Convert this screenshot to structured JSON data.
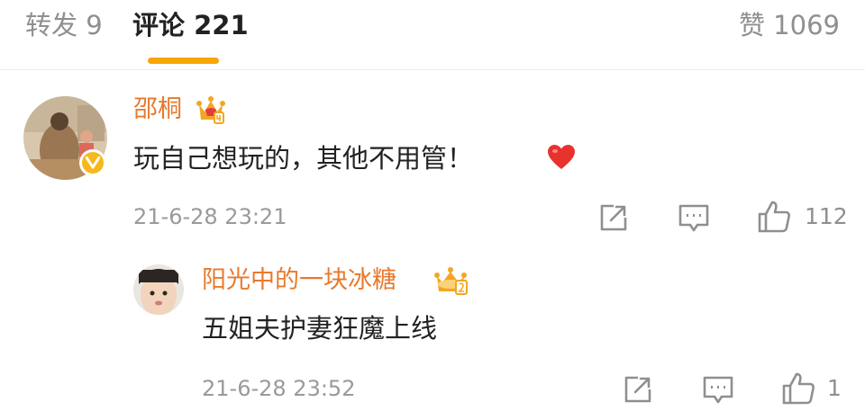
{
  "colors": {
    "accent": "#f7a600",
    "username": "#e8792c",
    "muted": "#9a9a9a",
    "heart": "#e8322e"
  },
  "tabs": {
    "repost": "转发 9",
    "comments": "评论 221",
    "likes": "赞 1069"
  },
  "comments": [
    {
      "username": "邵桐",
      "content": "玩自己想玩的，其他不用管！",
      "emoji": "heart-icon",
      "time": "21-6-28 23:21",
      "likes": "112",
      "verified": true
    },
    {
      "username": "阳光中的一块冰糖",
      "content": "五姐夫护妻狂魔上线",
      "time": "21-6-28 23:52",
      "likes": "1",
      "verified": false
    }
  ]
}
